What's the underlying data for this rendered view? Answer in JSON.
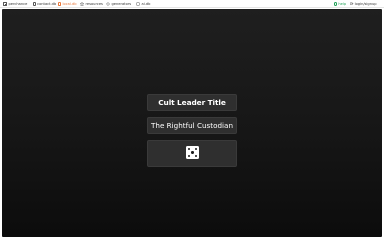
{
  "nav": {
    "items": [
      {
        "label": "perchance",
        "icon": "doc-icon"
      },
      {
        "label": "contact.db",
        "icon": "link-icon"
      },
      {
        "label": "local.db",
        "icon": "db-icon"
      },
      {
        "label": "resources",
        "icon": "star-icon"
      },
      {
        "label": "generators",
        "icon": "gear-icon"
      },
      {
        "label": "ai.db",
        "icon": "shield-icon"
      }
    ],
    "active_index": 2,
    "help_label": "help",
    "login_label": "login/signup"
  },
  "generator": {
    "title": "Cult Leader Title",
    "result": "The Rightful Custodian",
    "randomize_icon": "dice-five-icon"
  },
  "colors": {
    "active_nav": "#e8773a",
    "help": "#22a35a",
    "card_bg": "#2f2f2f",
    "stage_bg_top": "#1f1f1f",
    "stage_bg_bottom": "#0c0c0c"
  }
}
